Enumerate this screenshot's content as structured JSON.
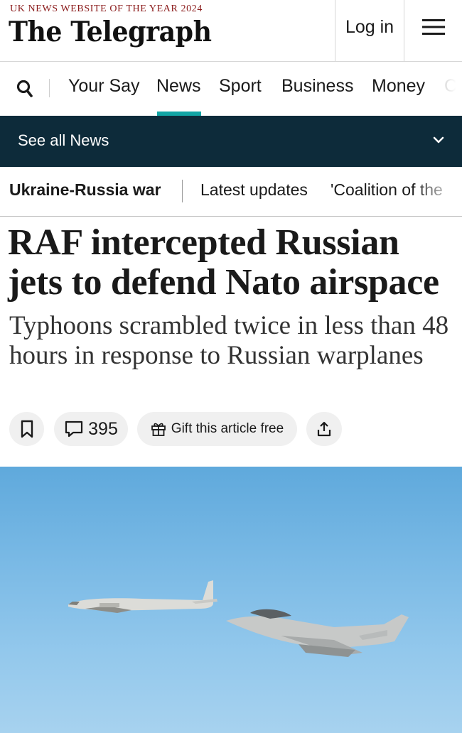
{
  "header": {
    "award": "UK NEWS WEBSITE OF THE YEAR 2024",
    "logo": "The Telegraph",
    "login_label": "Log in",
    "menu_icon": "hamburger-menu-icon"
  },
  "nav": {
    "search_icon": "search-icon",
    "items": [
      {
        "label": "Your Say"
      },
      {
        "label": "News",
        "active": true
      },
      {
        "label": "Sport"
      },
      {
        "label": "Business"
      },
      {
        "label": "Money"
      },
      {
        "label": "C"
      }
    ],
    "active_color": "#12a5a5"
  },
  "section_bar": {
    "label": "See all News",
    "chevron_icon": "chevron-down-icon",
    "background": "#0d2b3a"
  },
  "topic_bar": {
    "topic": "Ukraine-Russia war",
    "links": [
      "Latest updates",
      "'Coalition of the"
    ]
  },
  "article": {
    "headline": "RAF intercepted Russian jets to defend Nato airspace",
    "standfirst": "Typhoons scrambled twice in less than 48 hours in response to Russian warplanes",
    "comment_count": "395",
    "gift_label": "Gift this article free"
  },
  "hero": {
    "icon": "aircraft-photo"
  }
}
